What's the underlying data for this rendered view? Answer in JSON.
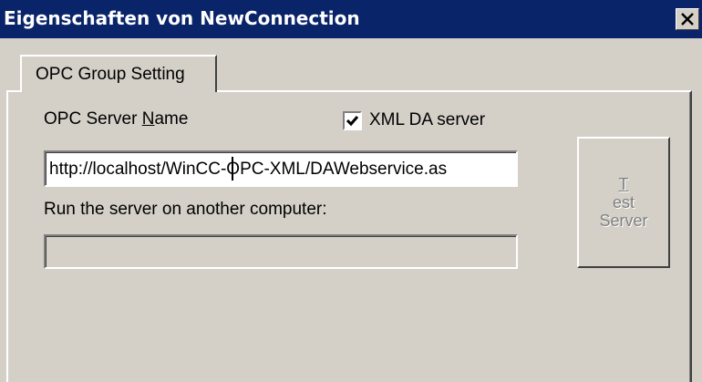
{
  "window": {
    "title": "Eigenschaften von NewConnection",
    "close_glyph": "×"
  },
  "tabs": [
    {
      "label": "OPC Group Setting",
      "selected": true
    }
  ],
  "form": {
    "server_name_label": "OPC Server Name",
    "server_name_mnemonic": "N",
    "xml_da_label": "XML DA server",
    "xml_da_checked": true,
    "server_url": "http://localhost/WinCC-OPC-XML/DAWebservice.as",
    "remote_label": "Run the server on another computer:",
    "remote_computer": ""
  },
  "buttons": {
    "test_server_line1": "Test",
    "test_server_line2": "Server",
    "test_server_enabled": false
  },
  "colors": {
    "titlebar": "#0a246a",
    "face": "#d4d0c8",
    "disabled_text": "#808080"
  }
}
